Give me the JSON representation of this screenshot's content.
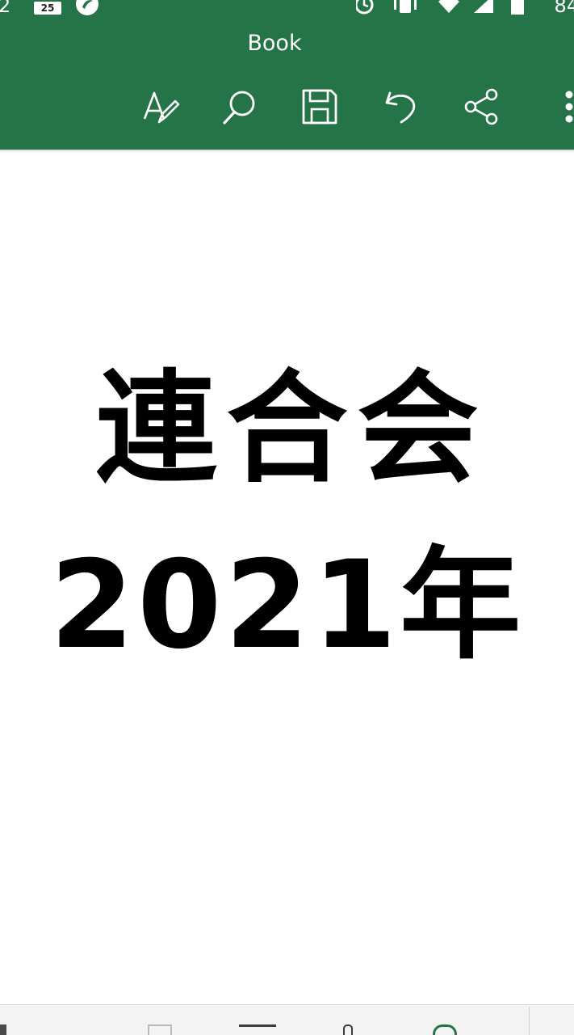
{
  "statusbar": {
    "time": "2",
    "badge": "25",
    "battery": "84"
  },
  "header": {
    "title": "Book",
    "toolbar": [
      {
        "name": "draw-icon"
      },
      {
        "name": "search-icon"
      },
      {
        "name": "save-icon"
      },
      {
        "name": "undo-icon"
      },
      {
        "name": "share-icon"
      },
      {
        "name": "more-icon"
      }
    ]
  },
  "document": {
    "line1": "連合会",
    "line2": "2021年"
  },
  "colors": {
    "appbar": "#257448",
    "text": "#000000",
    "background": "#ffffff"
  }
}
